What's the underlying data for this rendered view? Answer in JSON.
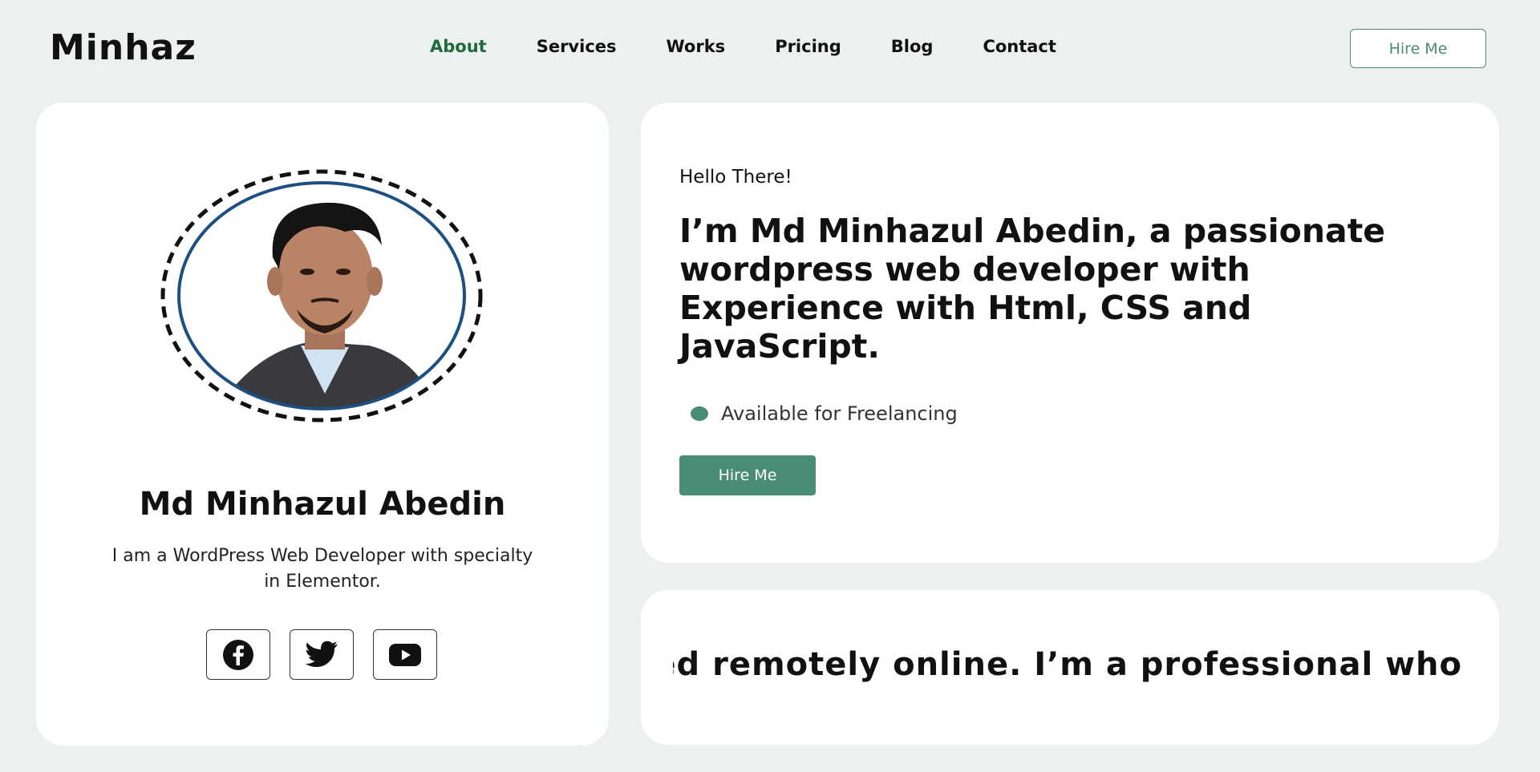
{
  "header": {
    "logo": "Minhaz",
    "nav": [
      {
        "label": "About",
        "active": true
      },
      {
        "label": "Services",
        "active": false
      },
      {
        "label": "Works",
        "active": false
      },
      {
        "label": "Pricing",
        "active": false
      },
      {
        "label": "Blog",
        "active": false
      },
      {
        "label": "Contact",
        "active": false
      }
    ],
    "hire_label": "Hire Me"
  },
  "profile": {
    "name": "Md Minhazul Abedin",
    "bio": "I am a WordPress Web Developer with specialty in Elementor.",
    "socials": [
      {
        "name": "facebook",
        "icon": "facebook-icon"
      },
      {
        "name": "twitter",
        "icon": "twitter-icon"
      },
      {
        "name": "youtube",
        "icon": "youtube-icon"
      }
    ]
  },
  "intro": {
    "greeting": "Hello There!",
    "headline_prefix": "I’m ",
    "headline_name": "Md Minhazul Abedin",
    "headline_rest": ", a passionate wordpress web developer with Experience with Html, CSS and JavaScript.",
    "availability": "Available for Freelancing",
    "hire_label": "Hire Me"
  },
  "marquee": {
    "text": "red remotely online. I’m a professional who"
  },
  "colors": {
    "accent": "#4a8c76",
    "nav_active": "#1d6b3a",
    "background": "#ecf1ef",
    "avatar_ring": "#1d4f82"
  }
}
